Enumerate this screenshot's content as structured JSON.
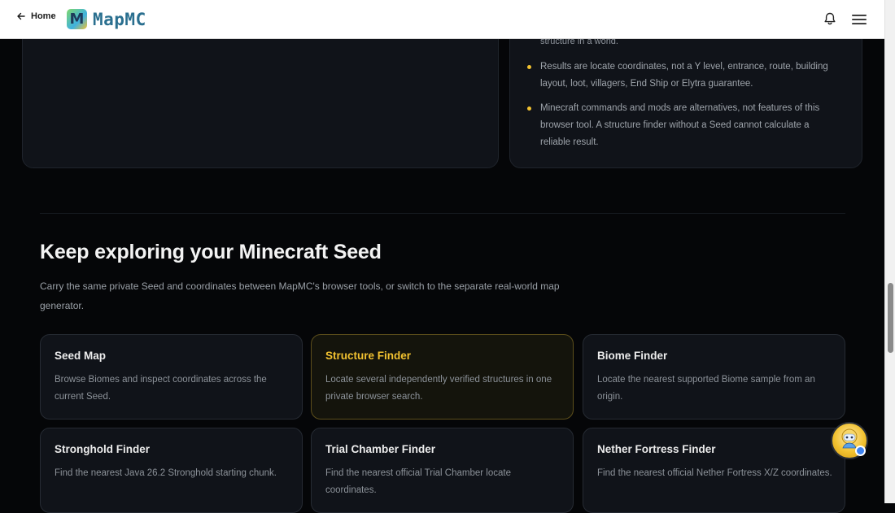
{
  "header": {
    "back_label": "Home",
    "logo_letter": "M",
    "logo_text": "MapMC",
    "icons": {
      "back": "arrow-left-icon",
      "bell": "bell-icon",
      "menu": "hamburger-menu-icon"
    }
  },
  "limits": {
    "partial_text": "structure in a world.",
    "bullets": [
      "Results are locate coordinates, not a Y level, entrance, route, building layout, loot, villagers, End Ship or Elytra guarantee.",
      "Minecraft commands and mods are alternatives, not features of this browser tool. A structure finder without a Seed cannot calculate a reliable result."
    ]
  },
  "explore": {
    "title": "Keep exploring your Minecraft Seed",
    "description": "Carry the same private Seed and coordinates between MapMC's browser tools, or switch to the separate real-world map generator.",
    "cards": [
      {
        "title": "Seed Map",
        "desc": "Browse Biomes and inspect coordinates across the current Seed."
      },
      {
        "title": "Structure Finder",
        "desc": "Locate several independently verified structures in one private browser search."
      },
      {
        "title": "Biome Finder",
        "desc": "Locate the nearest supported Biome sample from an origin."
      },
      {
        "title": "Stronghold Finder",
        "desc": "Find the nearest Java 26.2 Stronghold starting chunk."
      },
      {
        "title": "Trial Chamber Finder",
        "desc": "Find the nearest official Trial Chamber locate coordinates."
      },
      {
        "title": "Nether Fortress Finder",
        "desc": "Find the nearest official Nether Fortress X/Z coordinates."
      }
    ]
  },
  "colors": {
    "accent": "#f2c230",
    "background": "#050608",
    "card": "#101319"
  }
}
